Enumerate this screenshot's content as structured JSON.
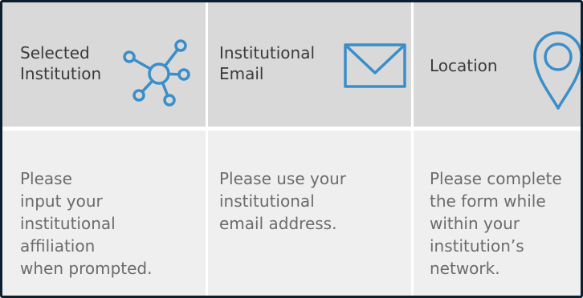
{
  "colors": {
    "header_bg": "#d9d9d9",
    "body_bg": "#efefef",
    "icon": "#3a8ec9",
    "title_text": "#3a3a3a",
    "desc_text": "#6b6b6b",
    "frame_border": "#0d1e2e"
  },
  "columns": [
    {
      "title": "Selected\nInstitution",
      "icon": "network-icon",
      "description": "Please\ninput your\ninstitutional\naffiliation\nwhen prompted."
    },
    {
      "title": "Institutional\nEmail",
      "icon": "envelope-icon",
      "description": "Please use your\ninstitutional\nemail address."
    },
    {
      "title": "Location",
      "icon": "map-pin-icon",
      "description": "Please complete\nthe form while\nwithin your\ninstitution’s\nnetwork."
    }
  ]
}
